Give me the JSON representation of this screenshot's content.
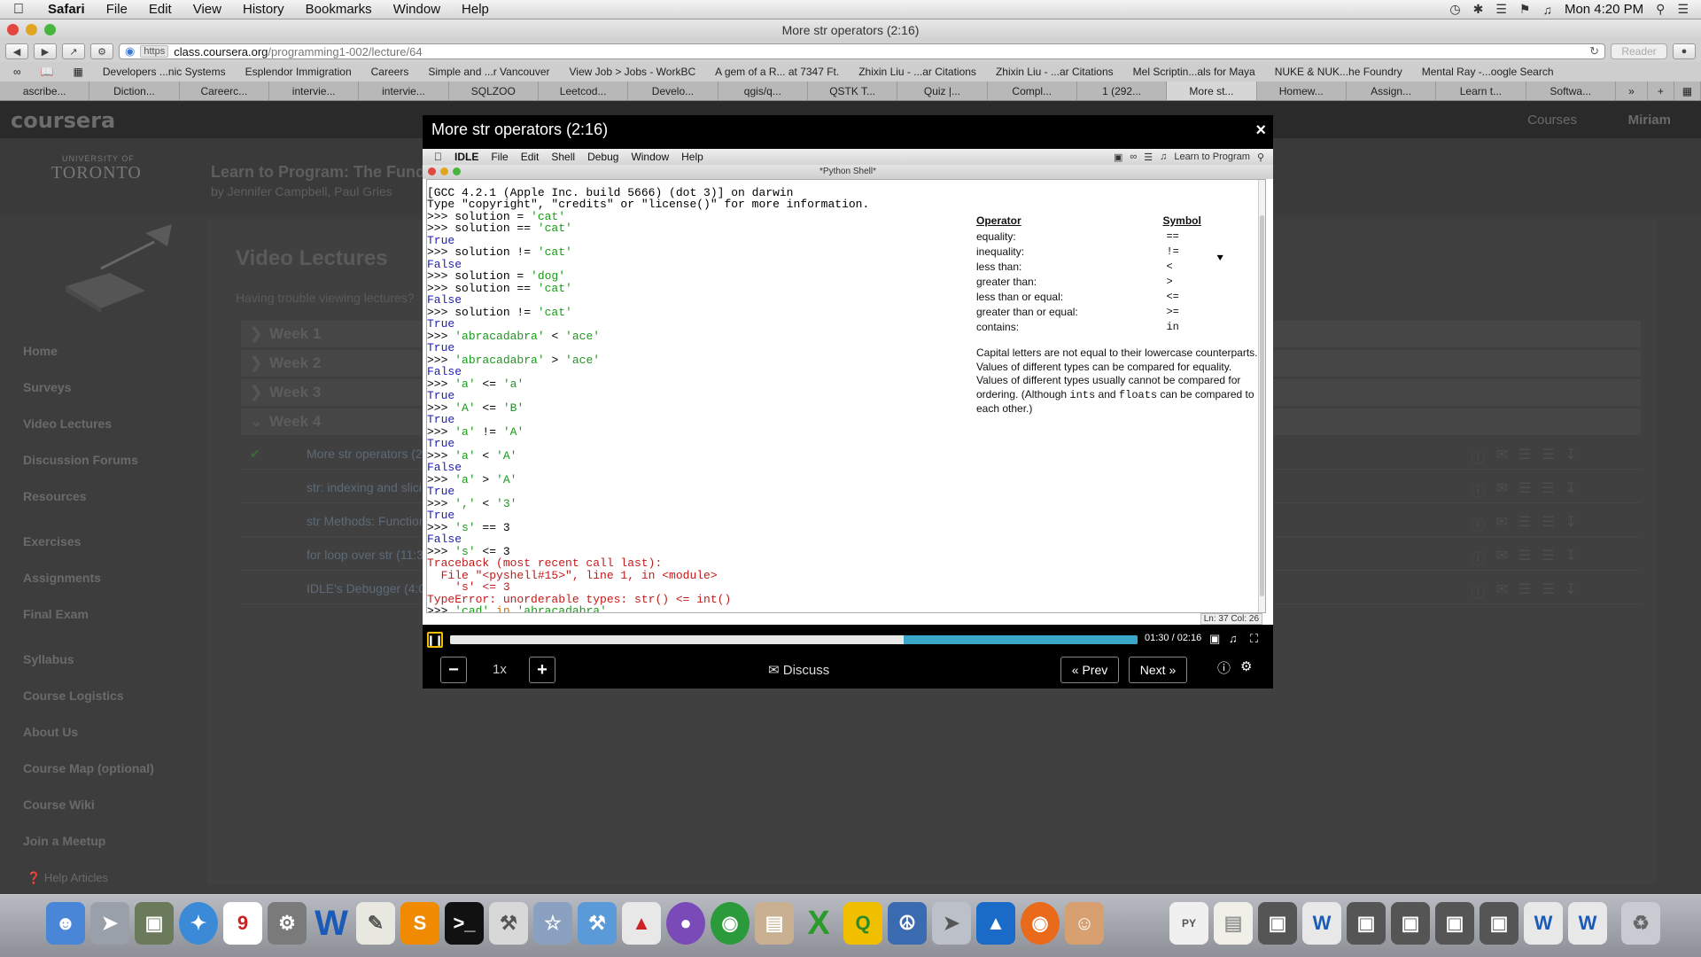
{
  "menubar": {
    "app": "Safari",
    "items": [
      "File",
      "Edit",
      "View",
      "History",
      "Bookmarks",
      "Window",
      "Help"
    ],
    "clock": "Mon 4:20 PM"
  },
  "window": {
    "title": "More str operators (2:16)"
  },
  "address": {
    "scheme": "https",
    "host": "class.coursera.org",
    "path": "/programming1-002/lecture/64",
    "reader": "Reader"
  },
  "bookmarks": [
    "Developers ...nic Systems",
    "Esplendor Immigration",
    "Careers",
    "Simple and ...r Vancouver",
    "View Job > Jobs - WorkBC",
    "A gem of a R... at 7347 Ft.",
    "Zhixin Liu - ...ar Citations",
    "Zhixin Liu - ...ar Citations",
    "Mel Scriptin...als for Maya",
    "NUKE & NUK...he Foundry",
    "Mental Ray -...oogle Search"
  ],
  "tabs": [
    "ascribe...",
    "Diction...",
    "Careerc...",
    "intervie...",
    "intervie...",
    "SQLZOO",
    "Leetcod...",
    "Develo...",
    "qgis/q...",
    "QSTK T...",
    "Quiz |...",
    "Compl...",
    "1 (292...",
    "More st...",
    "Homew...",
    "Assign...",
    "Learn t...",
    "Softwa..."
  ],
  "coursera": {
    "logo": "coursera",
    "nav_courses": "Courses",
    "nav_user": "Miriam",
    "uoft_small": "UNIVERSITY OF",
    "uoft_big": "TORONTO",
    "course_title": "Learn to Program: The Fund",
    "course_by": "by Jennifer Campbell, Paul Gries",
    "heading": "Video Lectures",
    "trouble": "Having trouble viewing lectures?",
    "sidebar": [
      "Home",
      "Surveys",
      "Video Lectures",
      "Discussion Forums",
      "Resources",
      "Exercises",
      "Assignments",
      "Final Exam",
      "Syllabus",
      "Course Logistics",
      "About Us",
      "Course Map (optional)",
      "Course Wiki",
      "Join a Meetup"
    ],
    "help": "Help Articles",
    "weeks": [
      "Week 1",
      "Week 2",
      "Week 3",
      "Week 4"
    ],
    "lectures": [
      "More str operators (2",
      "str: indexing and slici",
      "str Methods: Function",
      "for loop over str (11:3",
      "IDLE's Debugger (4:0"
    ]
  },
  "modal": {
    "title": "More str operators (2:16)",
    "close": "×",
    "idle_menu": [
      "IDLE",
      "File",
      "Edit",
      "Shell",
      "Debug",
      "Window",
      "Help"
    ],
    "idle_right": "Learn to Program",
    "shell_title": "*Python Shell*",
    "status": "Ln: 37 Col: 26",
    "operators_header": [
      "Operator",
      "Symbol"
    ],
    "operators": [
      {
        "name": "equality:",
        "sym": "=="
      },
      {
        "name": "inequality:",
        "sym": "!="
      },
      {
        "name": "less than:",
        "sym": "<"
      },
      {
        "name": "greater than:",
        "sym": ">"
      },
      {
        "name": "less than or equal:",
        "sym": "<="
      },
      {
        "name": "greater than or equal:",
        "sym": ">="
      },
      {
        "name": "contains:",
        "sym": "in"
      }
    ],
    "note1": "Capital letters are not equal to their lowercase counterparts.",
    "note2": "Values of different types can be compared for equality.",
    "note3a": "Values of different types usually cannot be compared for ordering. (Although ",
    "note3_ints": "ints",
    "note3b": " and ",
    "note3_floats": "floats",
    "note3c": " can be compared to each other.)",
    "time": "01:30 / 02:16",
    "progress_played": 0.66,
    "progress_buffered": 1.0,
    "speed": "1x",
    "discuss": "Discuss",
    "prev": "« Prev",
    "next": "Next »"
  }
}
